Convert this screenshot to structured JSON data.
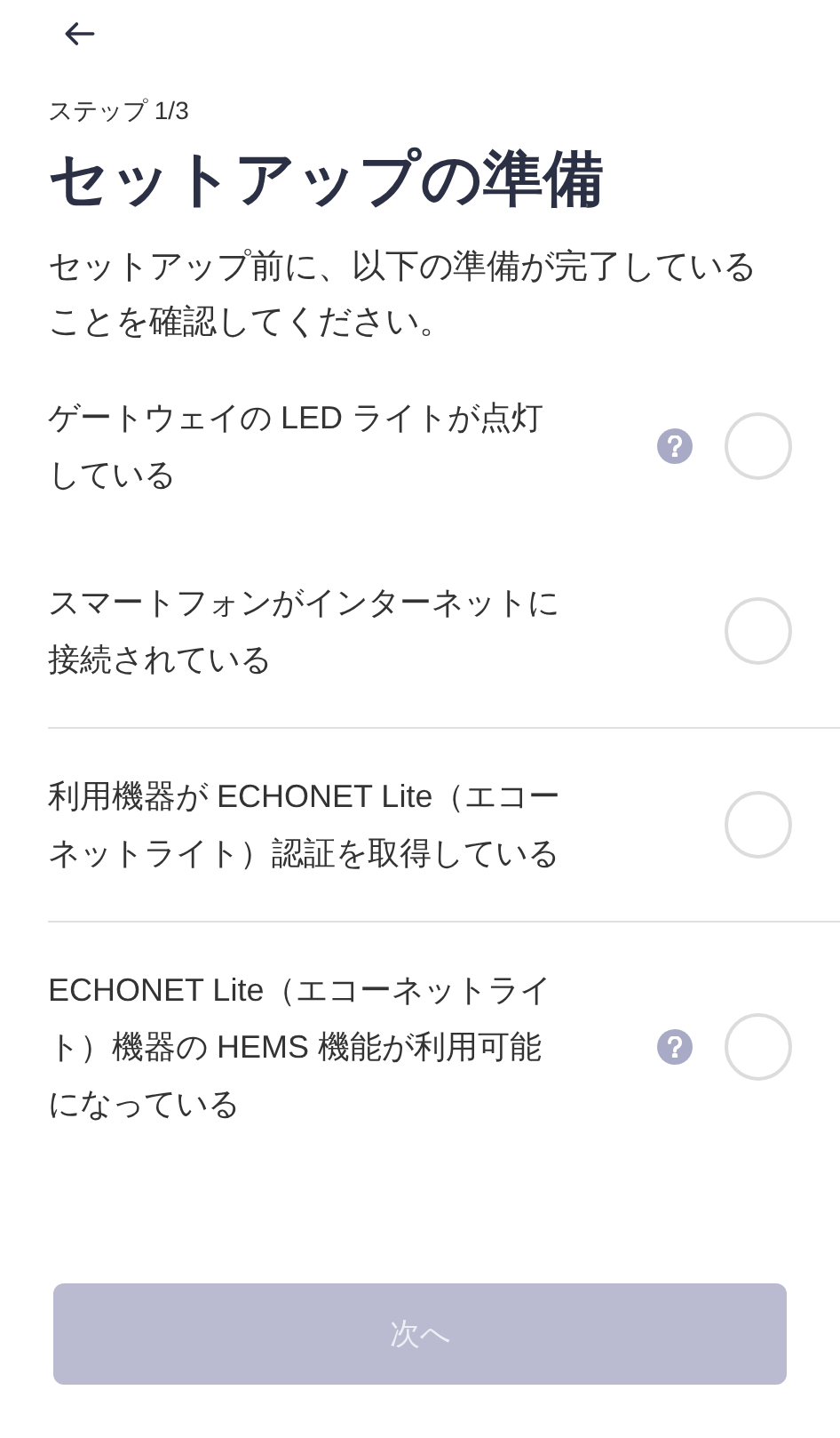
{
  "step": "ステップ 1/3",
  "title": "セットアップの準備",
  "intro": "セットアップ前に、以下の準備が完了していることを確認してください。",
  "sections": [
    [
      {
        "label": "ゲートウェイの LED ライトが点灯している",
        "help": true,
        "checked": false
      },
      {
        "label": "スマートフォンがインターネットに接続されている",
        "help": false,
        "checked": false
      }
    ],
    [
      {
        "label": "利用機器が ECHONET Lite（エコーネットライト）認証を取得している",
        "help": false,
        "checked": false
      }
    ],
    [
      {
        "label": "ECHONET Lite（エコーネットライト）機器の HEMS 機能が利用可能になっている",
        "help": true,
        "checked": false
      }
    ]
  ],
  "next_button": {
    "label": "次へ",
    "disabled": true
  }
}
